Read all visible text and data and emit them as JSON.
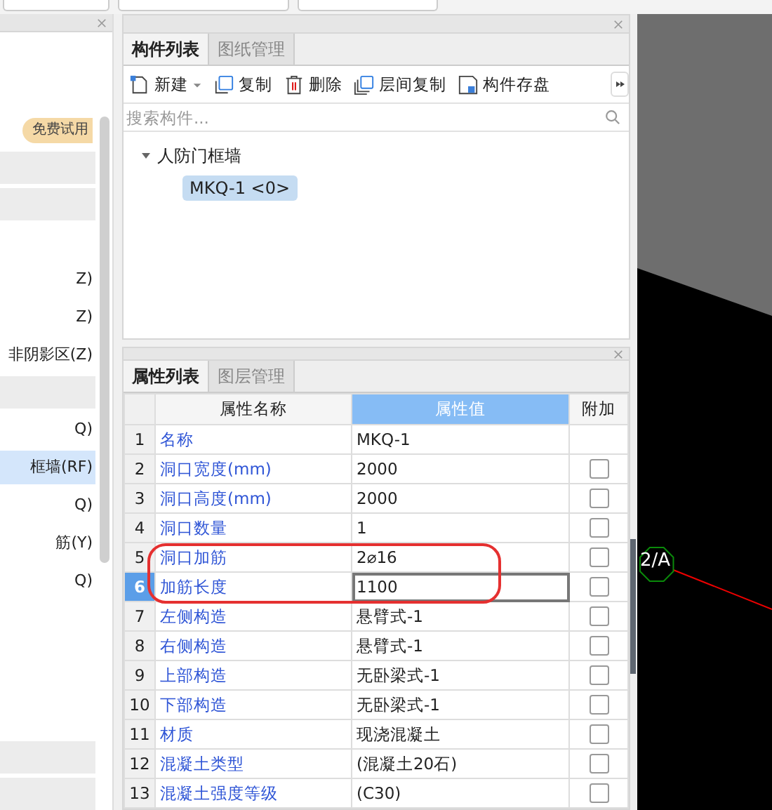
{
  "left_panel": {
    "badge": "免费试用",
    "items": [
      {
        "kind": "bar"
      },
      {
        "kind": "bar"
      },
      {
        "kind": "blank"
      },
      {
        "kind": "text",
        "label": "Z)",
        "selected": false
      },
      {
        "kind": "text",
        "label": "Z)",
        "selected": false
      },
      {
        "kind": "text",
        "label": "非阴影区(Z)",
        "selected": false
      },
      {
        "kind": "bar"
      },
      {
        "kind": "text",
        "label": "Q)",
        "selected": false
      },
      {
        "kind": "text",
        "label": "框墙(RF)",
        "selected": true
      },
      {
        "kind": "text",
        "label": "Q)",
        "selected": false
      },
      {
        "kind": "text",
        "label": "筋(Y)",
        "selected": false
      },
      {
        "kind": "text",
        "label": "Q)",
        "selected": false
      }
    ]
  },
  "component_panel": {
    "tabs": [
      {
        "label": "构件列表",
        "selected": true
      },
      {
        "label": "图纸管理",
        "selected": false
      }
    ],
    "toolbar": [
      {
        "kind": "new",
        "label": "新建",
        "dropdown": true
      },
      {
        "kind": "copy",
        "label": "复制",
        "dropdown": false
      },
      {
        "kind": "delete",
        "label": "删除",
        "dropdown": false
      },
      {
        "kind": "floor-copy",
        "label": "层间复制",
        "dropdown": false
      },
      {
        "kind": "save",
        "label": "构件存盘",
        "dropdown": false
      }
    ],
    "search": {
      "placeholder": "搜索构件..."
    },
    "tree": [
      {
        "label": "人防门框墙",
        "expanded": true,
        "children": [
          {
            "label": "MKQ-1 <0>",
            "selected": true
          }
        ]
      }
    ]
  },
  "property_panel": {
    "tabs": [
      {
        "label": "属性列表",
        "selected": true
      },
      {
        "label": "图层管理",
        "selected": false
      }
    ],
    "columns": [
      "属性名称",
      "属性值",
      "附加"
    ],
    "rows": [
      {
        "num": "1",
        "name": "名称",
        "value": "MKQ-1",
        "kind": "plain",
        "selected": false
      },
      {
        "num": "2",
        "name": "洞口宽度(mm)",
        "value": "2000",
        "kind": "check",
        "checked": false,
        "selected": false
      },
      {
        "num": "3",
        "name": "洞口高度(mm)",
        "value": "2000",
        "kind": "check",
        "checked": false,
        "selected": false
      },
      {
        "num": "4",
        "name": "洞口数量",
        "value": "1",
        "kind": "check",
        "checked": false,
        "selected": false
      },
      {
        "num": "5",
        "name": "洞口加筋",
        "value": "2⌀16",
        "kind": "check",
        "checked": false,
        "selected": false
      },
      {
        "num": "6",
        "name": "加筋长度",
        "value": "1100",
        "kind": "check",
        "checked": false,
        "selected": true
      },
      {
        "num": "7",
        "name": "左侧构造",
        "value": "悬臂式-1",
        "kind": "check",
        "checked": false,
        "selected": false
      },
      {
        "num": "8",
        "name": "右侧构造",
        "value": "悬臂式-1",
        "kind": "check",
        "checked": false,
        "selected": false
      },
      {
        "num": "9",
        "name": "上部构造",
        "value": "无卧梁式-1",
        "kind": "check",
        "checked": false,
        "selected": false
      },
      {
        "num": "10",
        "name": "下部构造",
        "value": "无卧梁式-1",
        "kind": "check",
        "checked": false,
        "selected": false
      },
      {
        "num": "11",
        "name": "材质",
        "value": "现浇混凝土",
        "kind": "check",
        "checked": false,
        "selected": false
      },
      {
        "num": "12",
        "name": "混凝土类型",
        "value": "(混凝土20石)",
        "kind": "check",
        "checked": false,
        "selected": false
      },
      {
        "num": "13",
        "name": "混凝土强度等级",
        "value": "(C30)",
        "kind": "check",
        "checked": false,
        "selected": false
      }
    ]
  },
  "canvas": {
    "axis_label": "2/A"
  }
}
